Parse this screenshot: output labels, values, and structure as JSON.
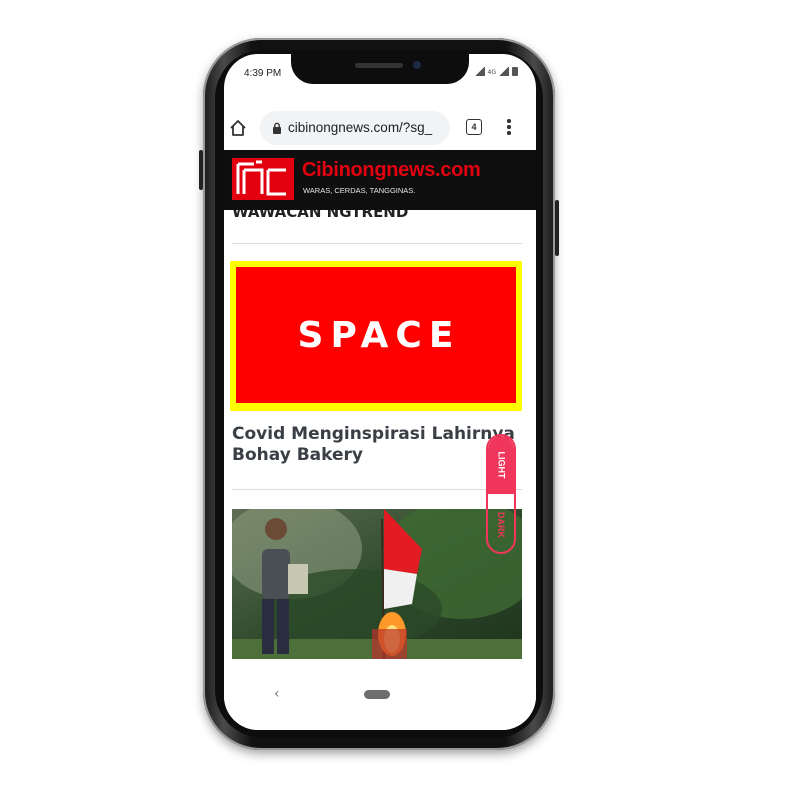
{
  "status_bar": {
    "time": "4:39 PM",
    "network": "4G"
  },
  "browser": {
    "url": "cibinongnews.com/?sg_",
    "tab_count": "4"
  },
  "site_header": {
    "name": "Cibinongnews.com",
    "tagline": "WARAS, CERDAS, TANGGINAS.",
    "accent_color": "#e3000f"
  },
  "content": {
    "cut_off_heading": "WAWACAN NGTREND",
    "ad_text": "SPACE",
    "article_title": "Covid Menginspirasi Lahirnya Bohay Bakery"
  },
  "theme_toggle": {
    "light_label": "LIGHT",
    "dark_label": "DARK",
    "accent_color": "#f0365a"
  },
  "nav_bar": {
    "back_glyph": "‹"
  }
}
